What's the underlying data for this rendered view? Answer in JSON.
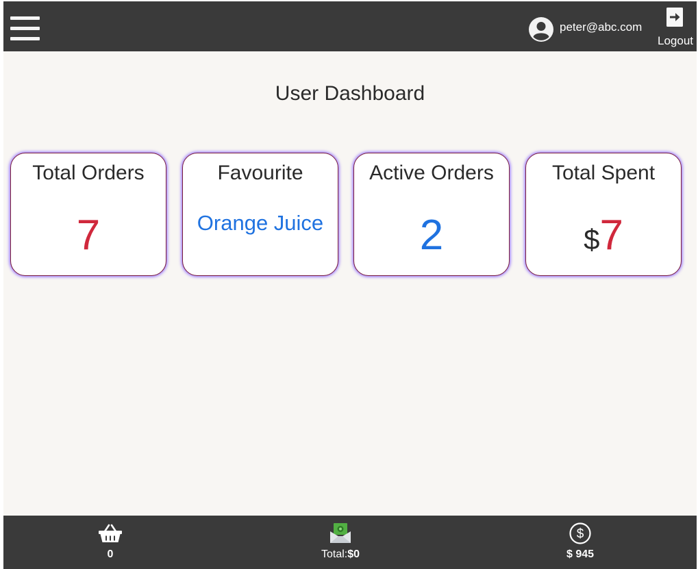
{
  "header": {
    "user_email": "peter@abc.com",
    "logout_label": "Logout"
  },
  "page": {
    "title": "User Dashboard"
  },
  "cards": {
    "total_orders": {
      "title": "Total Orders",
      "value": "7"
    },
    "favourite": {
      "title": "Favourite",
      "value": "Orange Juice"
    },
    "active_orders": {
      "title": "Active Orders",
      "value": "2"
    },
    "total_spent": {
      "title": "Total Spent",
      "currency": "$",
      "value": "7"
    }
  },
  "bottom_bar": {
    "cart_count": "0",
    "total_prefix": "Total:",
    "total_value": "$0",
    "balance": "$ 945"
  },
  "icons": {
    "menu": "hamburger-icon",
    "user": "user-avatar-icon",
    "logout": "logout-icon",
    "cart": "basket-icon",
    "total": "money-envelope-icon",
    "balance": "dollar-circle-icon"
  },
  "colors": {
    "bar_background": "#3a3a3a",
    "page_background": "#f8f6f3",
    "value_red": "#d0283c",
    "value_blue": "#1f72e0",
    "card_border": "#7a1e3c",
    "card_glow": "#6e3cff"
  }
}
